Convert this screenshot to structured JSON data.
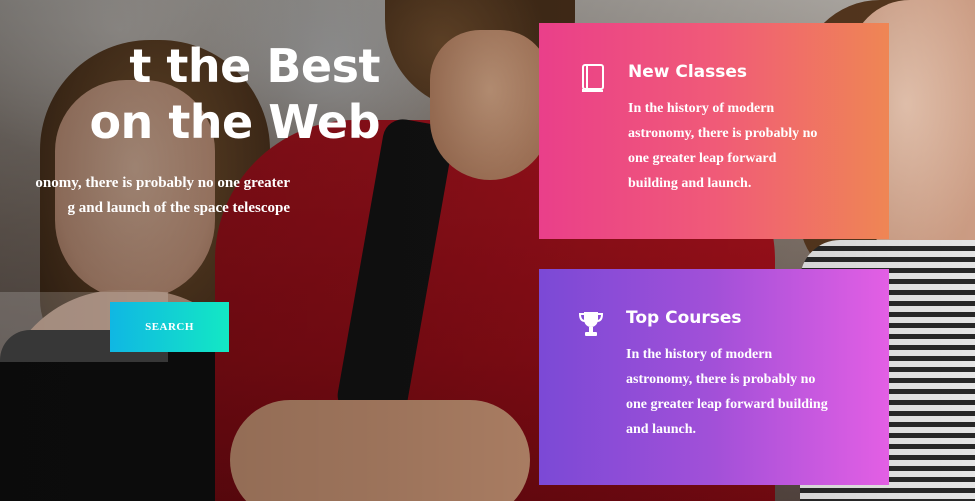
{
  "hero": {
    "title_lines": [
      "t the Best",
      "on the Web"
    ],
    "subtitle_lines": [
      "onomy, there is probably no one greater",
      "g and launch of the space telescope"
    ],
    "search_button_label": "SEARCH"
  },
  "cards": [
    {
      "title": "New Classes",
      "icon": "book-icon",
      "text_lines": [
        "In the history of modern",
        "astronomy, there is probably no",
        "one greater leap forward",
        "building and launch."
      ],
      "gradient": [
        "#ea3f8a",
        "#ef8654"
      ]
    },
    {
      "title": "Top Courses",
      "icon": "trophy-icon",
      "text_lines": [
        "In the history of modern",
        "astronomy, there is probably no",
        "one greater leap forward building",
        "and launch."
      ],
      "gradient": [
        "#7b49d6",
        "#e35fe4"
      ]
    }
  ],
  "colors": {
    "search_button": [
      "#10b7e3",
      "#13e8c4"
    ],
    "text": "#ffffff"
  }
}
